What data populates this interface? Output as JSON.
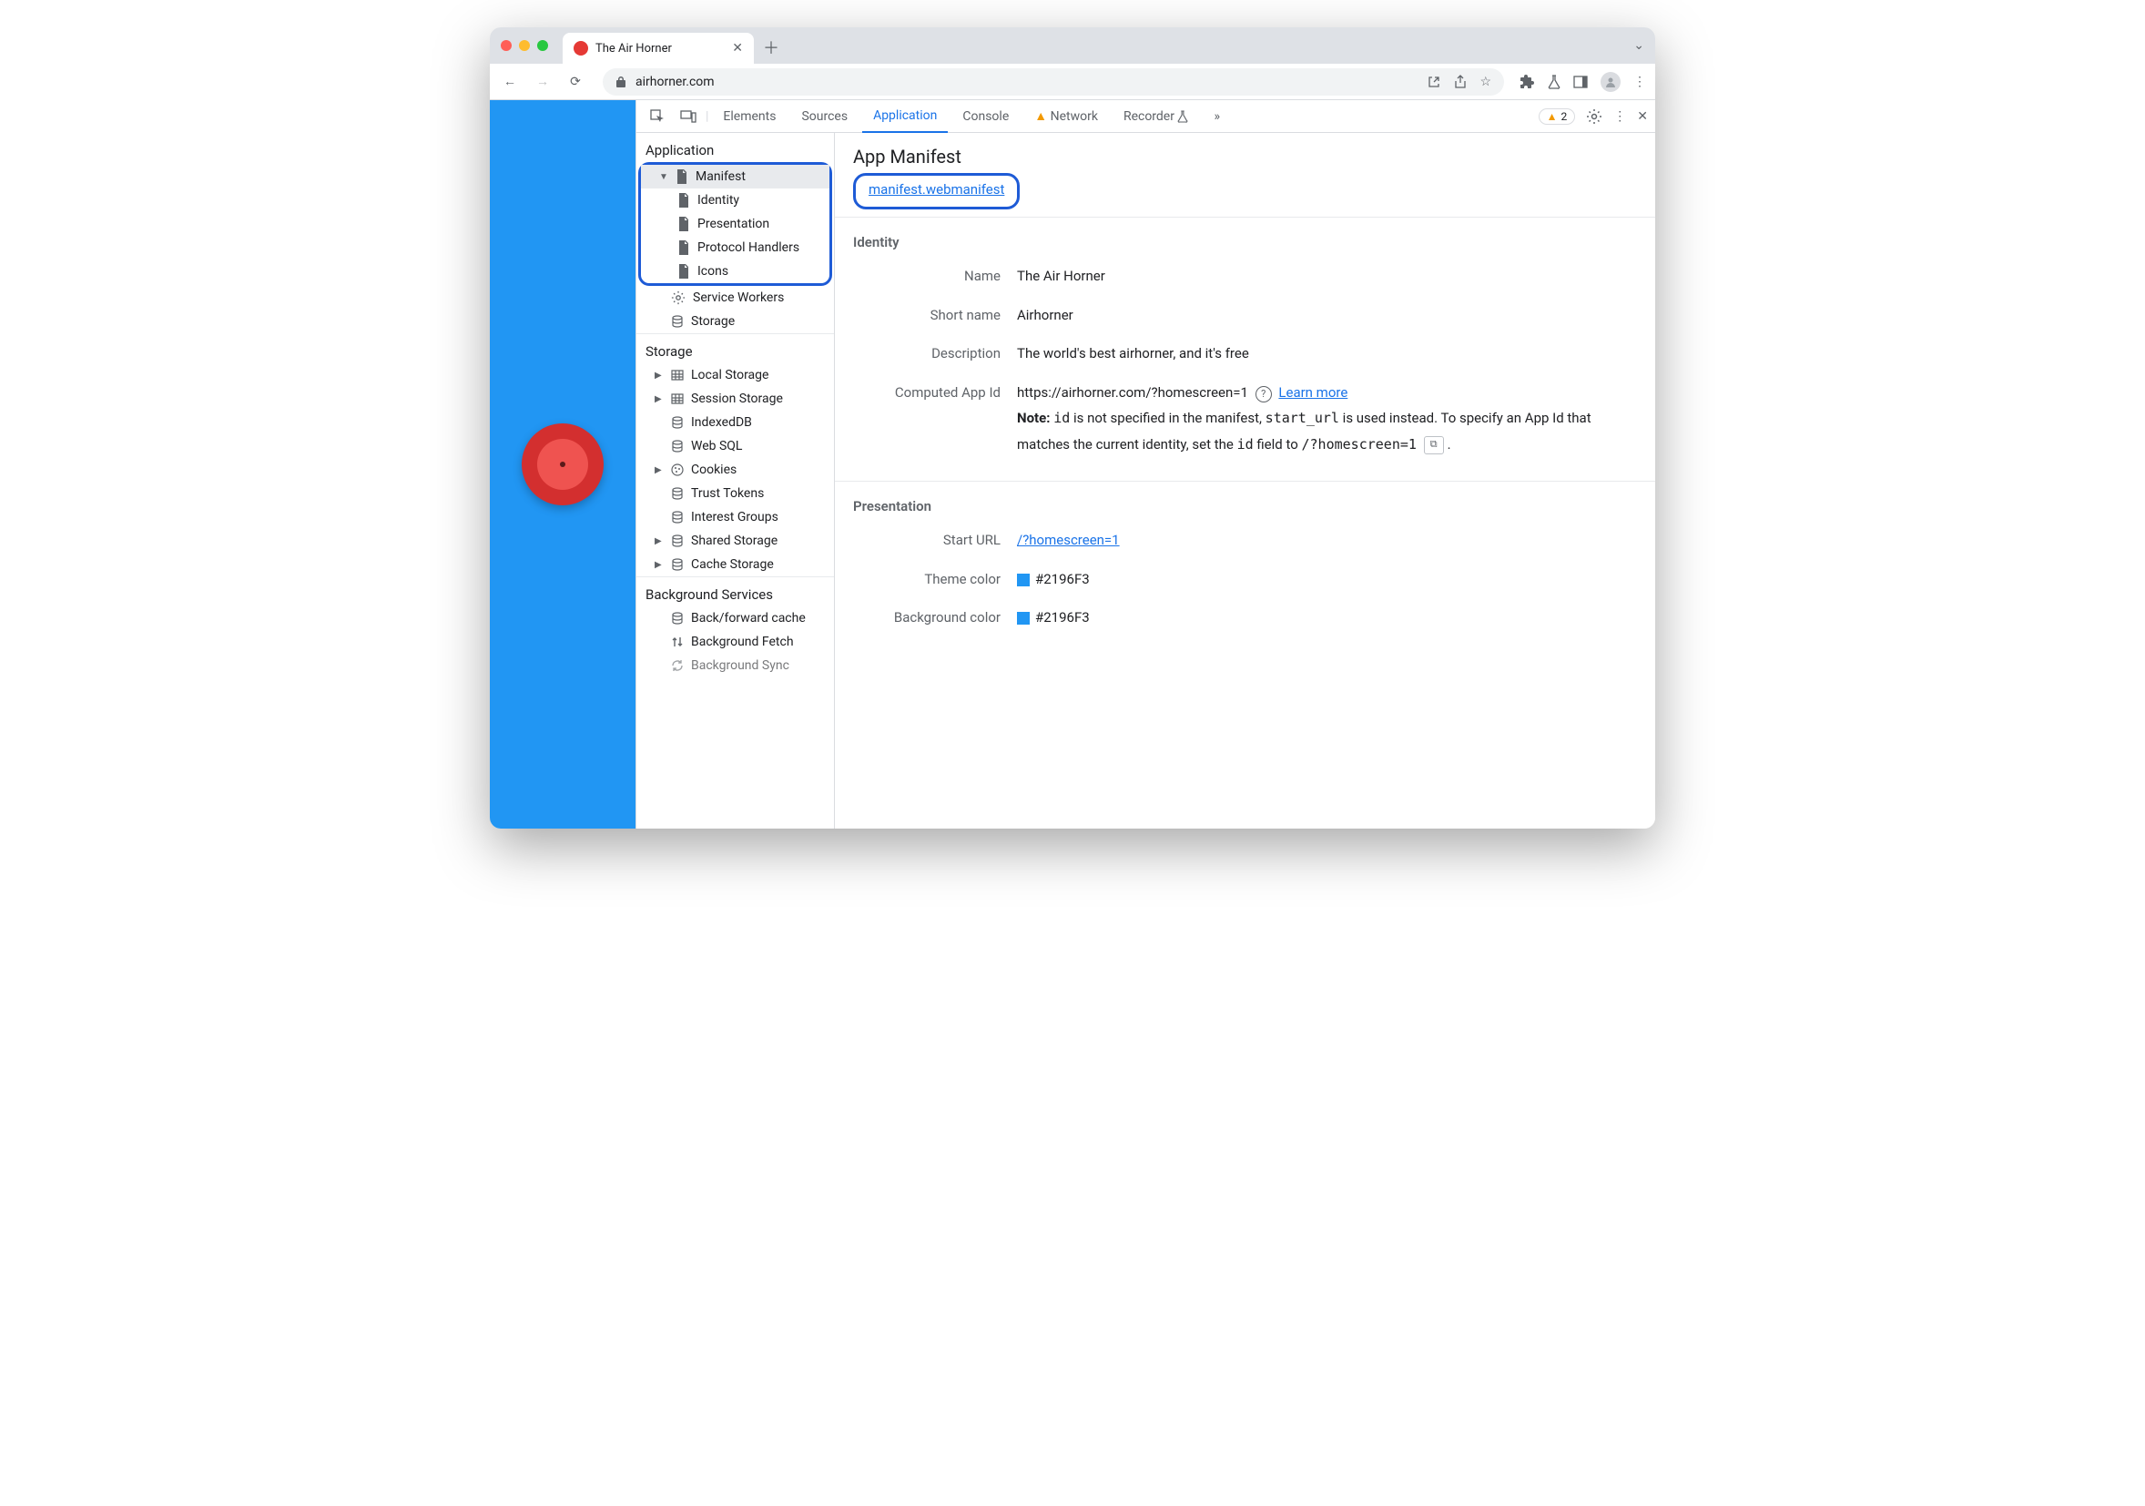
{
  "browser": {
    "tab_title": "The Air Horner",
    "url": "airhorner.com"
  },
  "devtools": {
    "tabs": [
      "Elements",
      "Sources",
      "Application",
      "Console",
      "Network",
      "Recorder"
    ],
    "active_tab": "Application",
    "warning_count": "2",
    "more_icon": "»"
  },
  "sidebar": {
    "application": {
      "title": "Application",
      "manifest": "Manifest",
      "manifest_children": [
        "Identity",
        "Presentation",
        "Protocol Handlers",
        "Icons"
      ],
      "service_workers": "Service Workers",
      "storage_item": "Storage"
    },
    "storage": {
      "title": "Storage",
      "items": [
        "Local Storage",
        "Session Storage",
        "IndexedDB",
        "Web SQL",
        "Cookies",
        "Trust Tokens",
        "Interest Groups",
        "Shared Storage",
        "Cache Storage"
      ]
    },
    "background": {
      "title": "Background Services",
      "items": [
        "Back/forward cache",
        "Background Fetch",
        "Background Sync"
      ]
    }
  },
  "manifest": {
    "title": "App Manifest",
    "link": "manifest.webmanifest",
    "identity": {
      "title": "Identity",
      "rows": {
        "name_label": "Name",
        "name_value": "The Air Horner",
        "short_label": "Short name",
        "short_value": "Airhorner",
        "desc_label": "Description",
        "desc_value": "The world's best airhorner, and it's free",
        "appid_label": "Computed App Id",
        "appid_value": "https://airhorner.com/?homescreen=1",
        "learn_more": "Learn more",
        "note_prefix": "Note:",
        "note_1": " is not specified in the manifest, ",
        "note_2": " is used instead. To specify an App Id that matches the current identity, set the ",
        "note_3": " field to ",
        "code_id": "id",
        "code_start_url": "start_url",
        "code_target": "/?homescreen=1"
      }
    },
    "presentation": {
      "title": "Presentation",
      "rows": {
        "start_label": "Start URL",
        "start_value": "/?homescreen=1",
        "theme_label": "Theme color",
        "theme_value": "#2196F3",
        "bg_label": "Background color",
        "bg_value": "#2196F3"
      }
    }
  }
}
